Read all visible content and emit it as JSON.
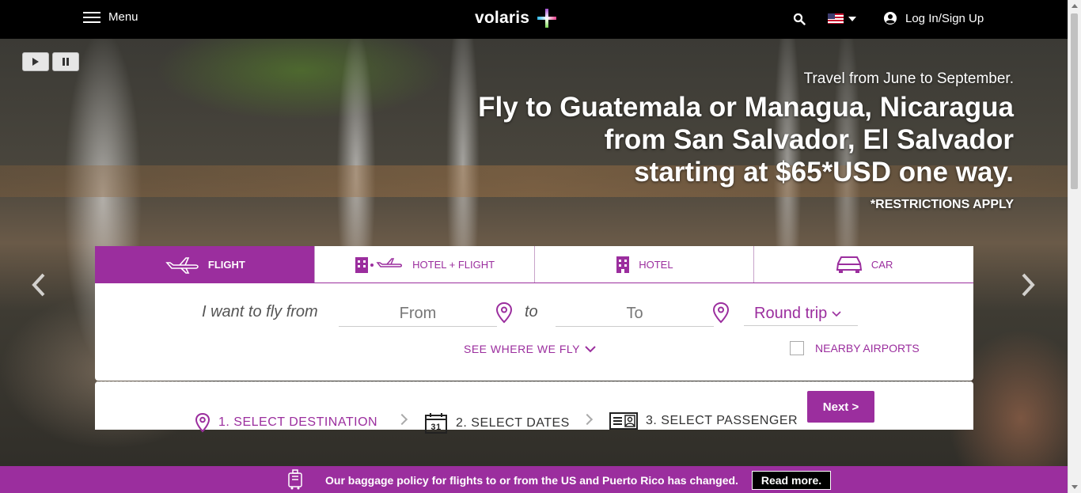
{
  "header": {
    "menu_label": "Menu",
    "logo_text": "volaris",
    "login_label": "Log In/Sign Up",
    "language_icon": "us-flag-icon"
  },
  "hero": {
    "subtitle": "Travel from June to September.",
    "headline_line1": "Fly to Guatemala or Managua, Nicaragua",
    "headline_line2": "from San Salvador, El Salvador",
    "headline_line3": "starting at $65*USD one way.",
    "restrictions": "*RESTRICTIONS APPLY"
  },
  "booking": {
    "tabs": [
      {
        "label": "FLIGHT",
        "icon": "airplane-icon",
        "active": true
      },
      {
        "label": "HOTEL + FLIGHT",
        "icon": "hotel-flight-icon",
        "active": false
      },
      {
        "label": "HOTEL",
        "icon": "hotel-icon",
        "active": false
      },
      {
        "label": "CAR",
        "icon": "car-icon",
        "active": false
      }
    ],
    "lead_text": "I want to fly from",
    "from_placeholder": "From",
    "to_word": "to",
    "to_placeholder": "To",
    "trip_type": "Round trip",
    "see_where": "SEE WHERE WE FLY",
    "nearby_label": "NEARBY AIRPORTS"
  },
  "steps": {
    "step1": "1. SELECT DESTINATION",
    "step2": "2. SELECT DATES",
    "step2_icon_text": "31",
    "step3": "3. SELECT PASSENGER",
    "next_label": "Next >"
  },
  "notice": {
    "text": "Our baggage policy for flights to or from the US and Puerto Rico has changed.",
    "read_more": "Read more."
  },
  "colors": {
    "brand_purple": "#9b2e9e",
    "topbar": "#000000"
  }
}
